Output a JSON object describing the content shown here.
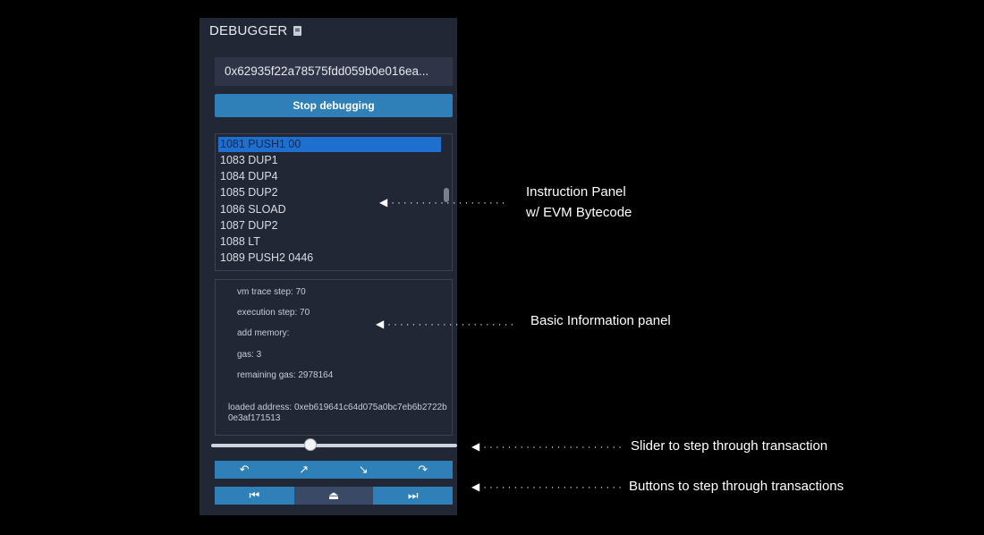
{
  "panel": {
    "title": "DEBUGGER",
    "tx_hash": "0x62935f22a78575fdd059b0e016ea...",
    "stop_button": "Stop debugging",
    "instructions": [
      {
        "text": "1081 PUSH1 00",
        "selected": true
      },
      {
        "text": "1083 DUP1",
        "selected": false
      },
      {
        "text": "1084 DUP4",
        "selected": false
      },
      {
        "text": "1085 DUP2",
        "selected": false
      },
      {
        "text": "1086 SLOAD",
        "selected": false
      },
      {
        "text": "1087 DUP2",
        "selected": false
      },
      {
        "text": "1088 LT",
        "selected": false
      },
      {
        "text": "1089 PUSH2 0446",
        "selected": false
      }
    ],
    "info": {
      "vm_trace_step": "vm trace step: 70",
      "execution_step": "execution step: 70",
      "add_memory": "add memory:",
      "gas": "gas: 3",
      "remaining_gas": "remaining gas: 2978164",
      "loaded_address": "loaded address: 0xeb619641c64d075a0bc7eb6b2722b0e3af171513"
    },
    "slider_position": 0.4,
    "step_buttons": [
      "step-back",
      "step-out",
      "step-into",
      "step-over"
    ],
    "jump_buttons": [
      "jump-previous-breakpoint",
      "jump-out",
      "jump-next-breakpoint"
    ]
  },
  "annotations": {
    "instruction_panel": "Instruction Panel",
    "instruction_panel_2": "w/ EVM Bytecode",
    "basic_info": "Basic Information panel",
    "slider": "Slider to step through transaction",
    "buttons": "Buttons to step through transactions"
  }
}
